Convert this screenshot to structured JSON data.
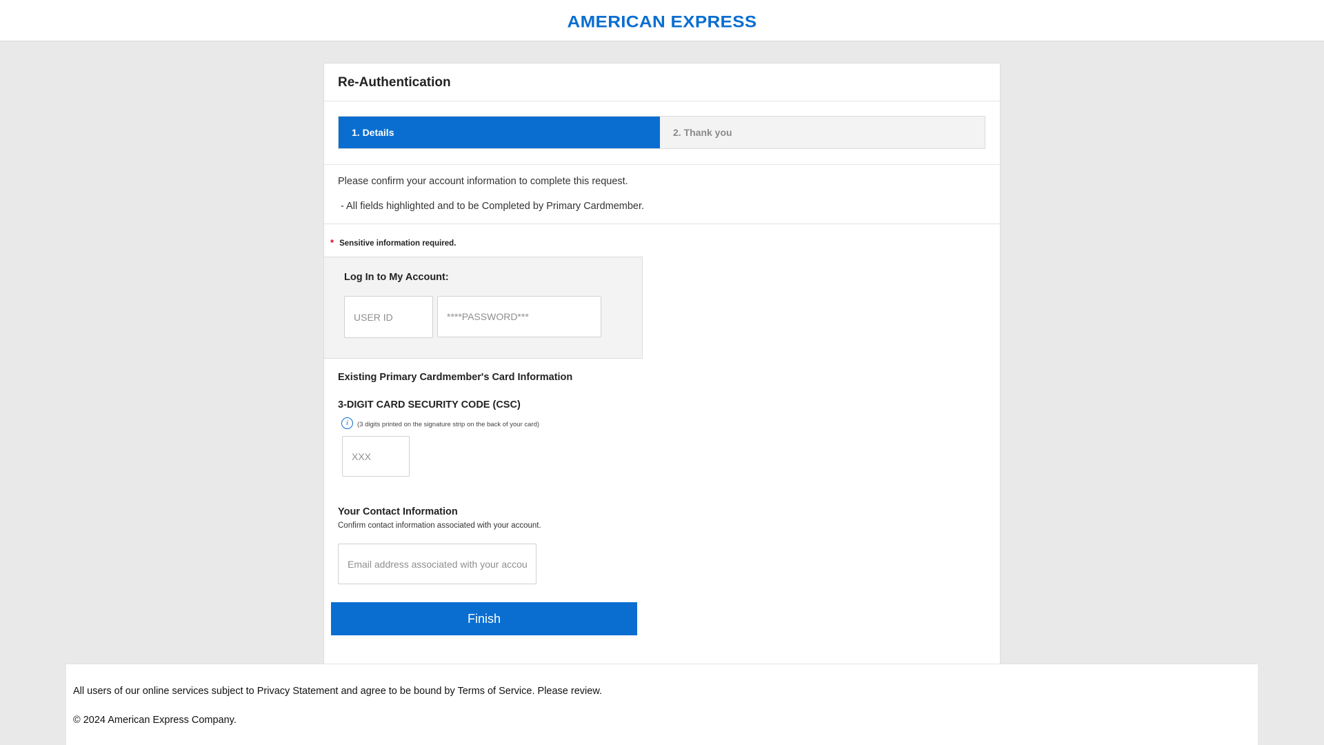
{
  "header": {
    "logo_text": "AMERICAN EXPRESS"
  },
  "colors": {
    "brand_blue": "#0a6ed1",
    "required_red": "#d0021b",
    "panel_gray": "#f3f3f3"
  },
  "card": {
    "title": "Re-Authentication",
    "steps": [
      {
        "label": "1. Details",
        "state": "active"
      },
      {
        "label": "2. Thank you",
        "state": "inactive"
      }
    ],
    "intro": "Please confirm your account information to complete this request.",
    "bullet": "-  All fields highlighted and to be Completed by Primary Cardmember.",
    "sensitive_star": "*",
    "sensitive_note": "Sensitive information required."
  },
  "login": {
    "title": "Log In to My Account:",
    "user_id": {
      "value": "",
      "placeholder": "USER ID"
    },
    "password": {
      "value": "",
      "placeholder": "****PASSWORD***"
    }
  },
  "card_info": {
    "title": "Existing Primary Cardmember's Card Information",
    "csc_label": "3-DIGIT CARD SECURITY CODE (CSC)",
    "info_icon": "info-icon",
    "info_glyph": "i",
    "csc_hint": "(3 digits printed on the signature strip on the back of your card)",
    "csc": {
      "value": "",
      "placeholder": "XXX"
    }
  },
  "contact": {
    "title": "Your Contact Information",
    "subtitle": "Confirm contact information associated with your account.",
    "email": {
      "value": "",
      "placeholder": "Email address associated with your account"
    }
  },
  "actions": {
    "finish_label": "Finish"
  },
  "footer": {
    "terms": "All users of our online services subject to Privacy Statement and agree to be bound by Terms of Service. Please review.",
    "copyright": "© 2024 American Express Company."
  }
}
